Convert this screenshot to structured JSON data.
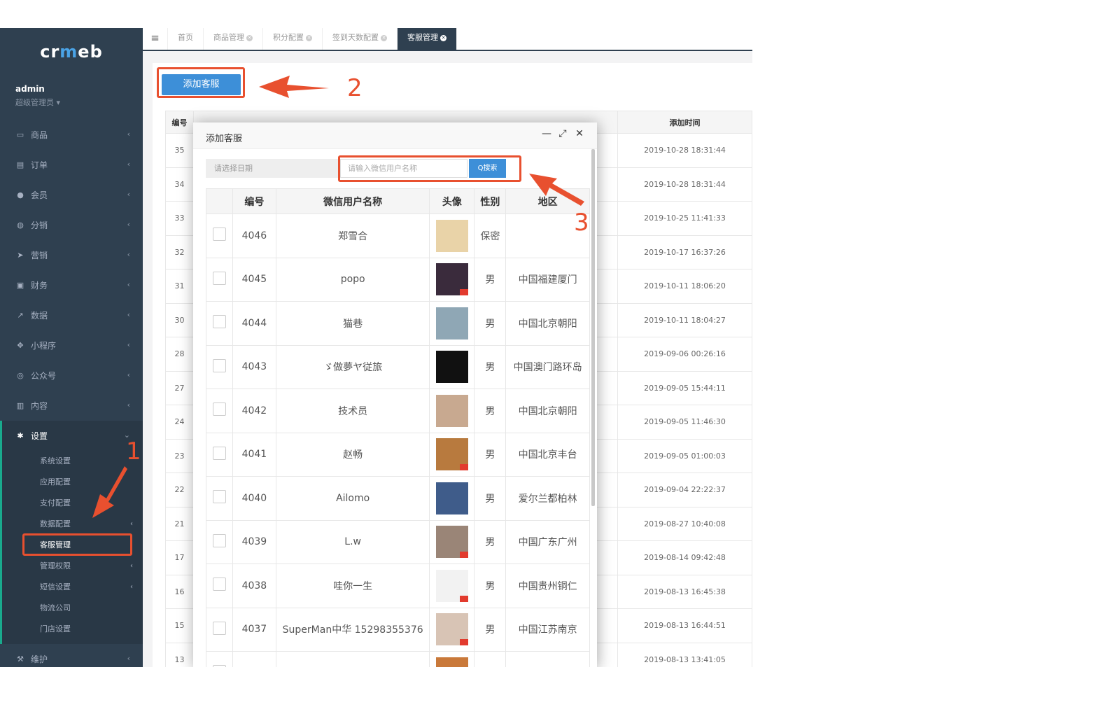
{
  "brand": {
    "logo_text": "crmeb"
  },
  "user": {
    "name": "admin",
    "role": "超级管理员 ▾"
  },
  "menu": [
    {
      "label": "商品",
      "icon": "laptop-icon"
    },
    {
      "label": "订单",
      "icon": "file-icon"
    },
    {
      "label": "会员",
      "icon": "user-icon"
    },
    {
      "label": "分销",
      "icon": "users-icon"
    },
    {
      "label": "营销",
      "icon": "send-icon"
    },
    {
      "label": "财务",
      "icon": "money-icon"
    },
    {
      "label": "数据",
      "icon": "chart-icon"
    },
    {
      "label": "小程序",
      "icon": "cubes-icon"
    },
    {
      "label": "公众号",
      "icon": "wechat-icon"
    },
    {
      "label": "内容",
      "icon": "book-icon"
    }
  ],
  "settings": {
    "label": "设置",
    "sub": [
      "系统设置",
      "应用配置",
      "支付配置",
      "数据配置",
      "客服管理",
      "管理权限",
      "短信设置",
      "物流公司",
      "门店设置"
    ]
  },
  "maintenance": {
    "label": "维护"
  },
  "tabs": [
    {
      "label": "首页"
    },
    {
      "label": "商品管理"
    },
    {
      "label": "积分配置"
    },
    {
      "label": "签到天数配置"
    },
    {
      "label": "客服管理"
    }
  ],
  "page": {
    "add_button": "添加客服",
    "col_id": "编号",
    "col_time": "添加时间"
  },
  "bg_rows": [
    {
      "id": "35",
      "time": "2019-10-28 18:31:44"
    },
    {
      "id": "34",
      "time": "2019-10-28 18:31:44"
    },
    {
      "id": "33",
      "time": "2019-10-25 11:41:33"
    },
    {
      "id": "32",
      "time": "2019-10-17 16:37:26"
    },
    {
      "id": "31",
      "time": "2019-10-11 18:06:20"
    },
    {
      "id": "30",
      "time": "2019-10-11 18:04:27"
    },
    {
      "id": "28",
      "time": "2019-09-06 00:26:16"
    },
    {
      "id": "27",
      "time": "2019-09-05 15:44:11"
    },
    {
      "id": "24",
      "time": "2019-09-05 11:46:30"
    },
    {
      "id": "23",
      "time": "2019-09-05 01:00:03"
    },
    {
      "id": "22",
      "time": "2019-09-04 22:22:37"
    },
    {
      "id": "21",
      "time": "2019-08-27 10:40:08"
    },
    {
      "id": "17",
      "time": "2019-08-14 09:42:48"
    },
    {
      "id": "16",
      "time": "2019-08-13 16:45:38"
    },
    {
      "id": "15",
      "time": "2019-08-13 16:44:51"
    },
    {
      "id": "13",
      "time": "2019-08-13 13:41:05"
    }
  ],
  "modal": {
    "title": "添加客服",
    "date_placeholder": "请选择日期",
    "name_placeholder": "请输入微信用户名称",
    "search_label": "Q搜索",
    "headers": [
      "",
      "编号",
      "微信用户名称",
      "头像",
      "性别",
      "地区"
    ],
    "rows": [
      {
        "id": "4046",
        "name": "郑雪合",
        "gender": "保密",
        "region": "",
        "avatar": "#e9d3a8"
      },
      {
        "id": "4045",
        "name": "popo",
        "gender": "男",
        "region": "中国福建厦门",
        "avatar": "#3a2b3c"
      },
      {
        "id": "4044",
        "name": "猫巷",
        "gender": "男",
        "region": "中国北京朝阳",
        "avatar": "#8fa7b5"
      },
      {
        "id": "4043",
        "name": "ゞ做夢ヤ従旅",
        "gender": "男",
        "region": "中国澳门路环岛",
        "avatar": "#111111"
      },
      {
        "id": "4042",
        "name": "技术员",
        "gender": "男",
        "region": "中国北京朝阳",
        "avatar": "#c8a990"
      },
      {
        "id": "4041",
        "name": "赵畅",
        "gender": "男",
        "region": "中国北京丰台",
        "avatar": "#b87a3e"
      },
      {
        "id": "4040",
        "name": "Ailomo",
        "gender": "男",
        "region": "爱尔兰都柏林",
        "avatar": "#3f5c8a"
      },
      {
        "id": "4039",
        "name": "L.w",
        "gender": "男",
        "region": "中国广东广州",
        "avatar": "#9a8577"
      },
      {
        "id": "4038",
        "name": "哇你一生",
        "gender": "男",
        "region": "中国贵州铜仁",
        "avatar": "#f2f2f2"
      },
      {
        "id": "4037",
        "name": "SuperMan中华 15298355376",
        "gender": "男",
        "region": "中国江苏南京",
        "avatar": "#d8c4b5"
      },
      {
        "id": "",
        "name": "",
        "gender": "",
        "region": "",
        "avatar": "#c9793a"
      }
    ]
  },
  "annotations": {
    "n1": "1",
    "n2": "2",
    "n3": "3",
    "color": "#e8502f"
  }
}
